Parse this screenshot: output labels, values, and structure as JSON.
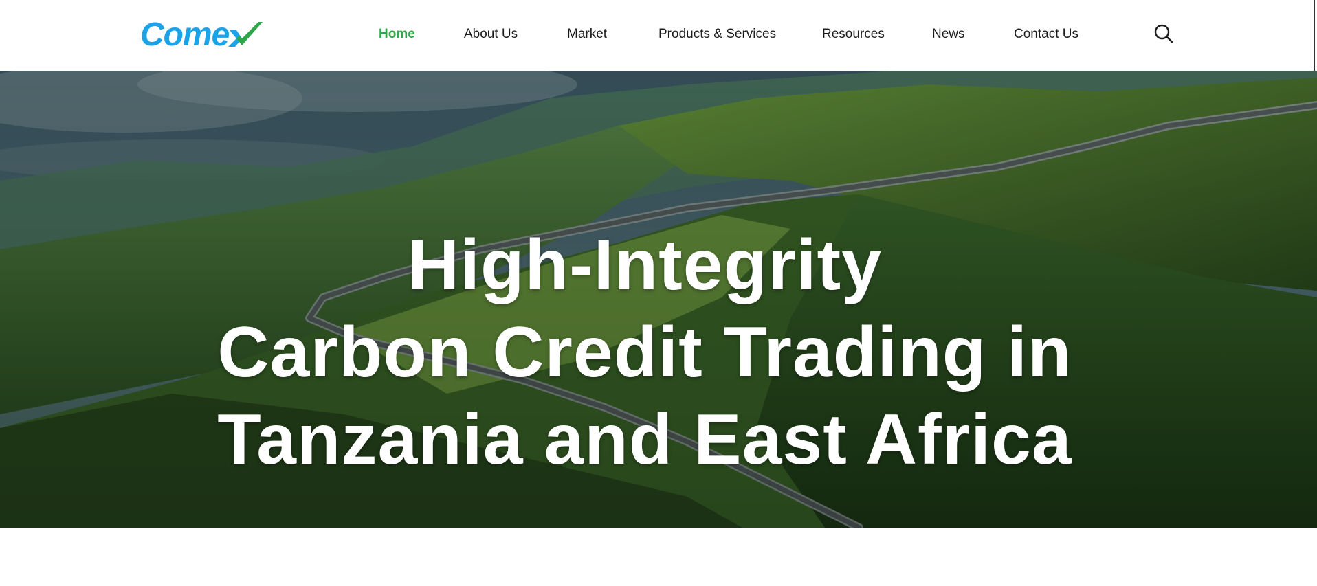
{
  "header": {
    "logo_text": "Come",
    "logo_accent_color": "#2ea84a",
    "logo_color": "#1aa3e8"
  },
  "nav": {
    "items": [
      {
        "label": "Home",
        "active": true
      },
      {
        "label": "About Us",
        "active": false
      },
      {
        "label": "Market",
        "active": false
      },
      {
        "label": "Products & Services",
        "active": false
      },
      {
        "label": "Resources",
        "active": false
      },
      {
        "label": "News",
        "active": false
      },
      {
        "label": "Contact Us",
        "active": false
      }
    ],
    "active_color": "#2ea84a",
    "search_icon": "search-icon"
  },
  "hero": {
    "title_lines": [
      "High-Integrity",
      "Carbon Credit Trading in",
      "Tanzania and East Africa"
    ],
    "background": "mountain-landscape-with-winding-road"
  }
}
